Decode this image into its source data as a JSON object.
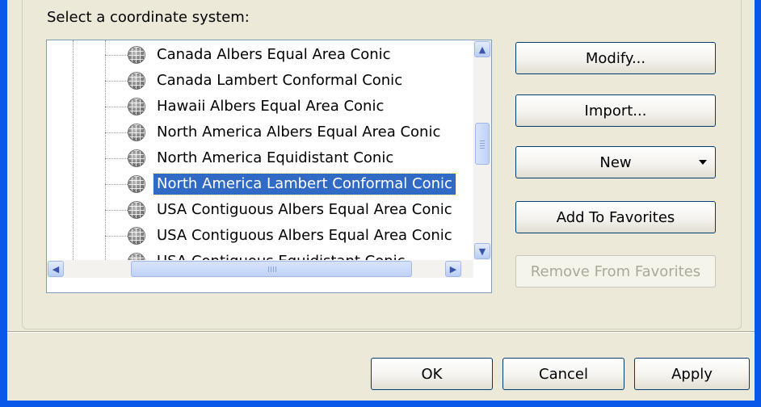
{
  "dialog": {
    "select_label": "Select a coordinate system:",
    "list_items": [
      {
        "label": "Canada Albers Equal Area Conic",
        "selected": false
      },
      {
        "label": "Canada Lambert Conformal Conic",
        "selected": false
      },
      {
        "label": "Hawaii Albers Equal Area Conic",
        "selected": false
      },
      {
        "label": "North America Albers Equal Area Conic",
        "selected": false
      },
      {
        "label": "North America Equidistant Conic",
        "selected": false
      },
      {
        "label": "North America Lambert Conformal Conic",
        "selected": true
      },
      {
        "label": "USA Contiguous Albers Equal Area Conic",
        "selected": false
      },
      {
        "label": "USA Contiguous Albers Equal Area Conic",
        "selected": false
      },
      {
        "label": "USA Contiguous Equidistant Conic",
        "selected": false
      }
    ],
    "side_buttons": {
      "modify": "Modify...",
      "import": "Import...",
      "new": "New",
      "add_favorites": "Add To Favorites",
      "remove_favorites": "Remove From Favorites"
    },
    "footer_buttons": {
      "ok": "OK",
      "cancel": "Cancel",
      "apply": "Apply"
    }
  },
  "colors": {
    "frame": "#0a58e8",
    "selection": "#316ac5",
    "dialog_bg": "#ece9d8"
  }
}
